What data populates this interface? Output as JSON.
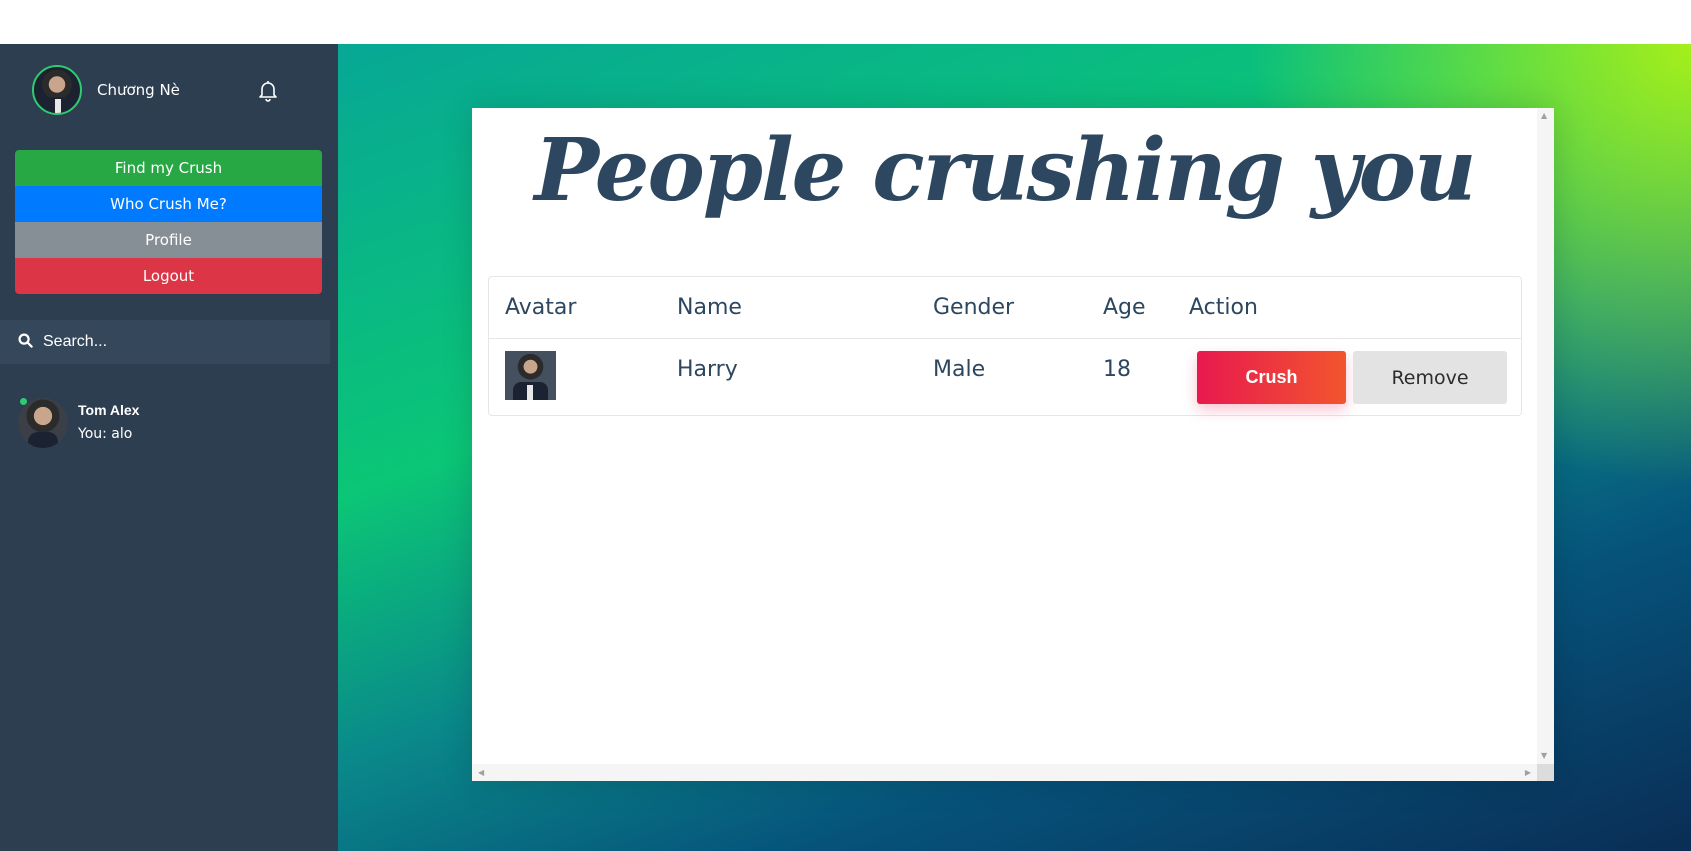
{
  "user": {
    "name": "Chương Nè"
  },
  "icons": {
    "bell": "bell-icon",
    "search": "search-icon"
  },
  "menu": {
    "find_crush": "Find my Crush",
    "who_crush_me": "Who Crush Me?",
    "profile": "Profile",
    "logout": "Logout"
  },
  "search": {
    "placeholder": "Search..."
  },
  "contacts": [
    {
      "name": "Tom Alex",
      "last_message": "You: alo",
      "online": true
    }
  ],
  "main": {
    "heading": "People crushing you",
    "table": {
      "headers": [
        "Avatar",
        "Name",
        "Gender",
        "Age",
        "Action"
      ],
      "rows": [
        {
          "name": "Harry",
          "gender": "Male",
          "age": "18",
          "crush_label": "Crush",
          "remove_label": "Remove"
        }
      ]
    }
  },
  "colors": {
    "sidebar_bg": "#2d3e50",
    "find_crush": "#28a745",
    "who_crush_me": "#007bff",
    "profile": "#868e96",
    "logout": "#dc3545",
    "heading_text": "#2c475f",
    "crush_gradient_start": "#e8194f",
    "crush_gradient_end": "#f2552e"
  }
}
